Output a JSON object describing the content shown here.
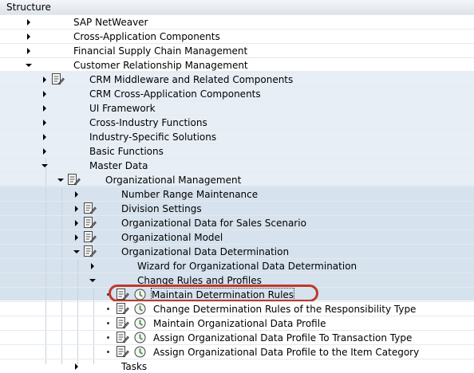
{
  "header": {
    "title": "Structure"
  },
  "tree": {
    "rows": [
      {
        "label": "SAP NetWeaver"
      },
      {
        "label": "Cross-Application Components"
      },
      {
        "label": "Financial Supply Chain Management"
      },
      {
        "label": "Customer Relationship Management"
      },
      {
        "label": "CRM Middleware and Related Components"
      },
      {
        "label": "CRM Cross-Application Components"
      },
      {
        "label": "UI Framework"
      },
      {
        "label": "Cross-Industry Functions"
      },
      {
        "label": "Industry-Specific Solutions"
      },
      {
        "label": "Basic Functions"
      },
      {
        "label": "Master Data"
      },
      {
        "label": "Organizational Management"
      },
      {
        "label": "Number Range Maintenance"
      },
      {
        "label": "Division Settings"
      },
      {
        "label": "Organizational Data for Sales Scenario"
      },
      {
        "label": "Organizational Model"
      },
      {
        "label": "Organizational Data Determination"
      },
      {
        "label": "Wizard for Organizational Data Determination"
      },
      {
        "label": "Change Rules and Profiles"
      },
      {
        "label": "Maintain Determination Rules"
      },
      {
        "label": "Change Determination Rules of the Responsibility Type"
      },
      {
        "label": "Maintain Organizational Data Profile"
      },
      {
        "label": "Assign Organizational Data Profile To Transaction Type"
      },
      {
        "label": "Assign Organizational Data Profile to the Item Category"
      },
      {
        "label": "Tasks"
      }
    ]
  }
}
